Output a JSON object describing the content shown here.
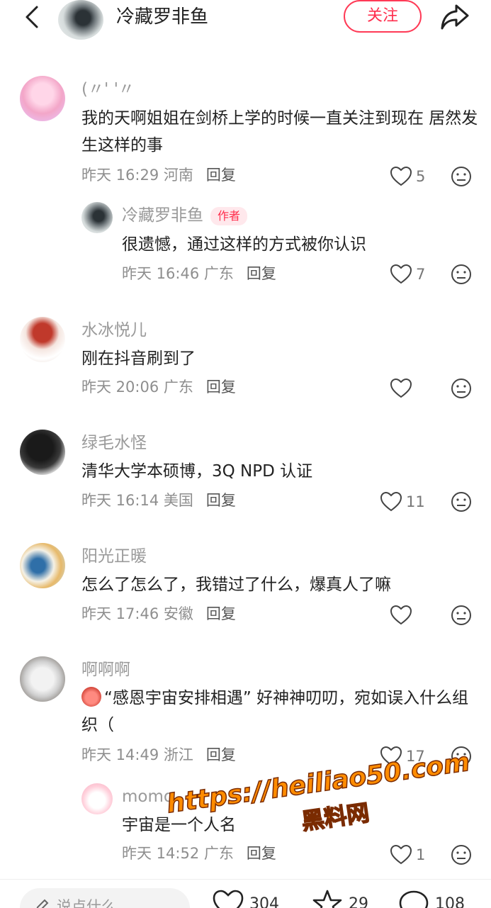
{
  "header": {
    "author_name": "冷藏罗非鱼",
    "follow_label": "关注"
  },
  "comments": [
    {
      "name": "(〃' '〃",
      "text": "我的天啊姐姐在剑桥上学的时候一直关注到现在 居然发生这样的事",
      "time": "昨天 16:29 河南",
      "reply": "回复",
      "likes": "5"
    },
    {
      "name": "冷藏罗非鱼",
      "tag": "作者",
      "text": "很遗憾，通过这样的方式被你认识",
      "time": "昨天 16:46 广东",
      "reply": "回复",
      "likes": "7"
    },
    {
      "name": "水冰悦儿",
      "text": "刚在抖音刷到了",
      "time": "昨天 20:06 广东",
      "reply": "回复",
      "likes": ""
    },
    {
      "name": "绿毛水怪",
      "text": "清华大学本硕博，3Q NPD 认证",
      "time": "昨天 16:14 美国",
      "reply": "回复",
      "likes": "11"
    },
    {
      "name": "阳光正暖",
      "text": "怎么了怎么了，我错过了什么，爆真人了嘛",
      "time": "昨天 17:46 安徽",
      "reply": "回复",
      "likes": ""
    },
    {
      "name": "啊啊啊",
      "text": "“感恩宇宙安排相遇” 好神神叨叨，宛如误入什么组织（",
      "time": "昨天 14:49 浙江",
      "reply": "回复",
      "likes": "17"
    },
    {
      "name": "momo",
      "text": "宇宙是一个人名",
      "time": "昨天 14:52 广东",
      "reply": "回复",
      "likes": "1"
    }
  ],
  "watermark": {
    "url": "https://heiliao50.com",
    "label": "黑料网"
  },
  "bottom": {
    "input_placeholder": "说点什么...",
    "likes": "304",
    "stars": "29",
    "comments": "108"
  }
}
